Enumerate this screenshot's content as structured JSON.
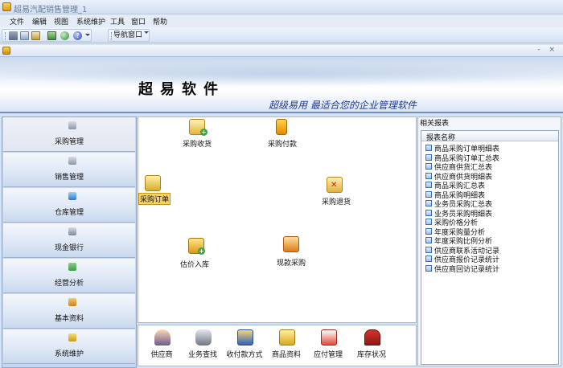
{
  "window": {
    "title": "超易汽配销售管理_1"
  },
  "menu": {
    "items": [
      "文件",
      "编辑",
      "视图",
      "系统维护",
      "工具",
      "窗口",
      "帮助"
    ]
  },
  "toolbar": {
    "nav_window_label": "导航窗口",
    "icons": [
      "cut-icon",
      "copy-icon",
      "paste-icon",
      "tree-icon",
      "globe-icon",
      "help-icon"
    ]
  },
  "banner": {
    "brand_name": "超易软件",
    "slogan": "超级易用 最适合您的企业管理软件"
  },
  "left_nav": {
    "items": [
      {
        "label": "采购管理",
        "icon": "purchase-icon",
        "active": true
      },
      {
        "label": "销售管理",
        "icon": "sales-icon"
      },
      {
        "label": "仓库管理",
        "icon": "warehouse-icon"
      },
      {
        "label": "现金银行",
        "icon": "cash-bank-icon"
      },
      {
        "label": "经营分析",
        "icon": "analysis-icon"
      },
      {
        "label": "基本资料",
        "icon": "basic-data-icon"
      },
      {
        "label": "系统维护",
        "icon": "system-maintenance-icon"
      }
    ]
  },
  "flow": {
    "purchase_receive": "采购收货",
    "purchase_payment": "采购付款",
    "purchase_order": "采购订单",
    "purchase_return": "采购退货",
    "estimated_stock_in": "估价入库",
    "cash_purchase": "现款采购"
  },
  "shortcuts": {
    "items": [
      {
        "label": "供应商",
        "icon": "supplier-icon"
      },
      {
        "label": "业务查找",
        "icon": "binoculars-icon"
      },
      {
        "label": "收付款方式",
        "icon": "payment-method-icon"
      },
      {
        "label": "商品资料",
        "icon": "goods-icon"
      },
      {
        "label": "应付管理",
        "icon": "calculator-icon"
      },
      {
        "label": "库存状况",
        "icon": "store-icon"
      }
    ]
  },
  "reports": {
    "title": "相关报表",
    "column_header": "报表名称",
    "items": [
      "商品采购订单明细表",
      "商品采购订单汇总表",
      "供应商供货汇总表",
      "供应商供货明细表",
      "商品采购汇总表",
      "商品采购明细表",
      "业务员采购汇总表",
      "业务员采购明细表",
      "采购价格分析",
      "年度采购量分析",
      "年度采购比例分析",
      "供应商联系活动记录",
      "供应商报价记录统计",
      "供应商回访记录统计"
    ]
  }
}
